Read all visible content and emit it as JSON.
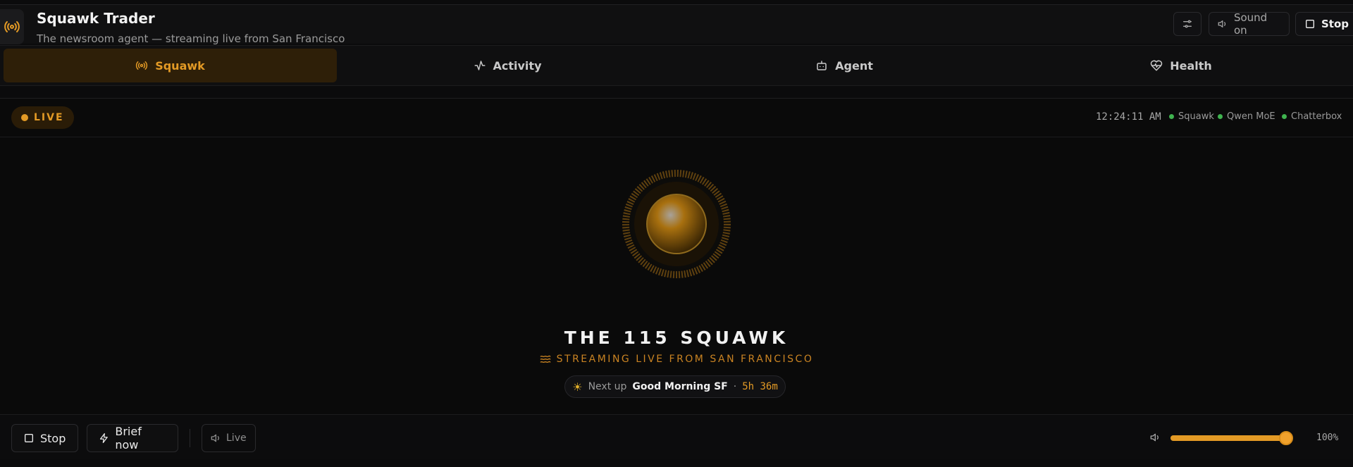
{
  "app": {
    "title": "Squawk Trader",
    "subtitle": "The newsroom agent — streaming live from San Francisco"
  },
  "topbar": {
    "settings_icon": "sliders-icon",
    "sound_label": "Sound on",
    "stop_label": "Stop"
  },
  "tabs": [
    {
      "label": "Squawk",
      "icon": "broadcast-icon",
      "active": true
    },
    {
      "label": "Activity",
      "icon": "activity-icon",
      "active": false
    },
    {
      "label": "Agent",
      "icon": "bot-icon",
      "active": false
    },
    {
      "label": "Health",
      "icon": "heart-pulse-icon",
      "active": false
    }
  ],
  "status": {
    "live_label": "LIVE",
    "clock": "12:24:11 AM",
    "services": [
      {
        "name": "Squawk",
        "state": "online"
      },
      {
        "name": "Qwen MoE",
        "state": "online"
      },
      {
        "name": "Chatterbox",
        "state": "online"
      }
    ]
  },
  "station": {
    "name": "THE 115 SQUAWK",
    "tagline": "STREAMING LIVE FROM SAN FRANCISCO",
    "next_prefix": "Next up",
    "next_show": "Good Morning SF",
    "separator": "·",
    "next_eta": "5h 36m"
  },
  "controls": {
    "stop_label": "Stop",
    "brief_label": "Brief now",
    "live_label": "Live",
    "volume": 1.0,
    "volume_text": "100%"
  },
  "colors": {
    "accent": "#e39a25",
    "online": "#3fb34f",
    "background": "#0a0a0a"
  }
}
